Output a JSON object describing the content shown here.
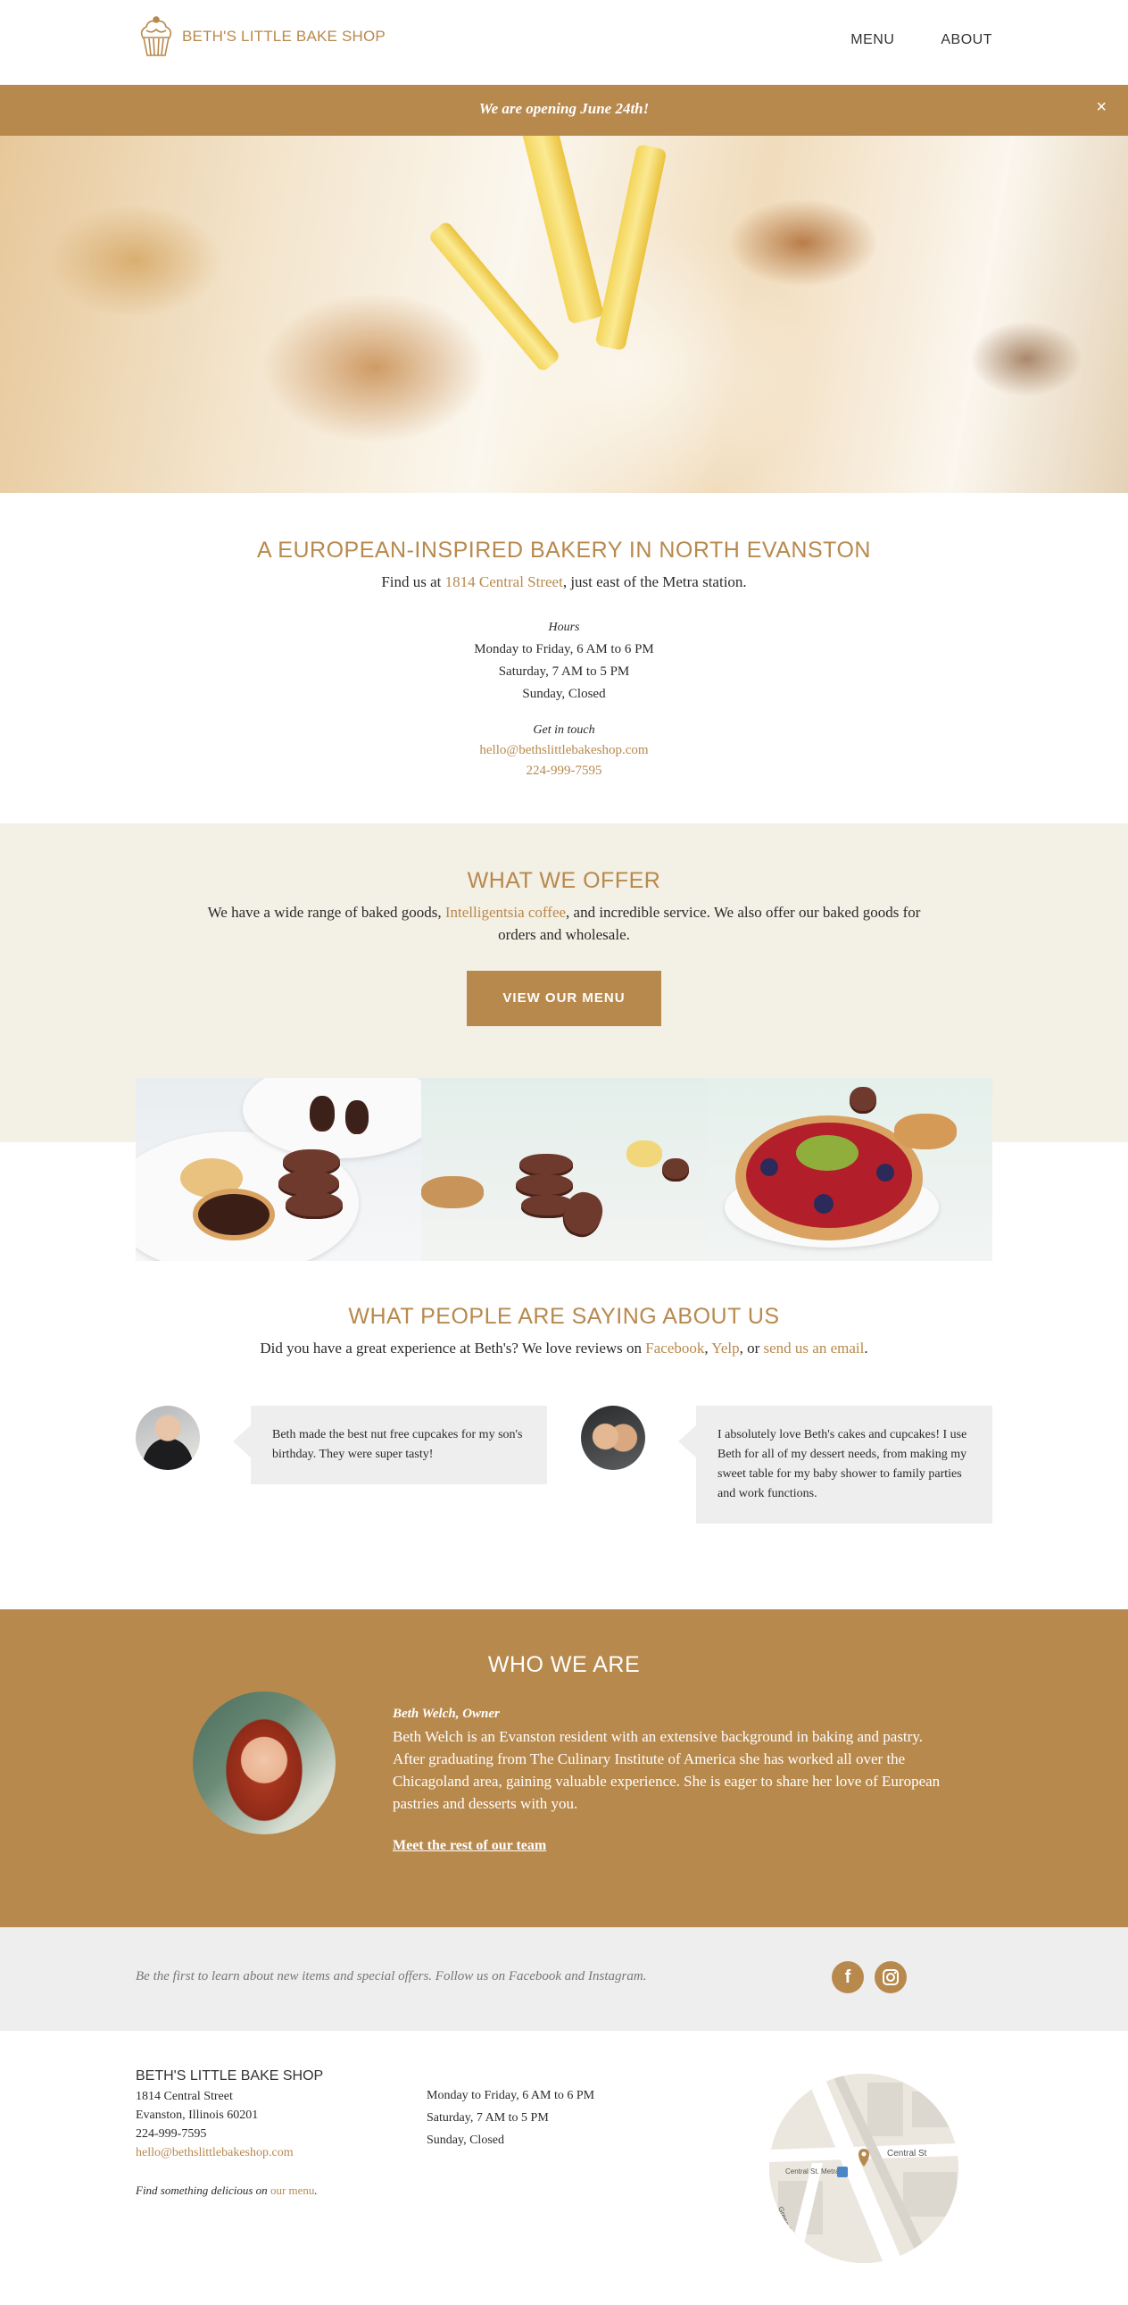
{
  "header": {
    "logo_text": "BETH'S LITTLE BAKE SHOP",
    "nav": [
      "MENU",
      "ABOUT"
    ]
  },
  "banner": {
    "text": "We are opening June 24th!",
    "close": "×"
  },
  "intro": {
    "title": "A EUROPEAN-INSPIRED BAKERY IN NORTH EVANSTON",
    "find_prefix": "Find us at ",
    "find_link": "1814 Central Street",
    "find_suffix": ", just east of the Metra station.",
    "hours_label": "Hours",
    "hours": [
      "Monday to Friday,  6 AM to 6 PM",
      "Saturday,  7 AM to 5 PM",
      "Sunday, Closed"
    ],
    "contact_label": "Get in touch",
    "email": "hello@bethslittlebakeshop.com",
    "phone": "224-999-7595"
  },
  "offer": {
    "title": "WHAT WE OFFER",
    "text_prefix": "We have a wide range of baked goods, ",
    "text_link": "Intelligentsia coffee",
    "text_suffix": ", and incredible service. We also offer our baked goods for orders and wholesale.",
    "button": "VIEW OUR MENU"
  },
  "reviews": {
    "title": "WHAT PEOPLE ARE SAYING ABOUT US",
    "lead_prefix": "Did you have a great experience at Beth's? We love reviews on ",
    "link_facebook": "Facebook",
    "sep1": ", ",
    "link_yelp": "Yelp",
    "sep2": ", or ",
    "link_email": "send us an email",
    "lead_suffix": ".",
    "items": [
      {
        "text": "Beth made the best nut free cupcakes for my son's birthday. They were super tasty!"
      },
      {
        "text": "I absolutely love Beth's cakes and cupcakes! I use Beth for all of my dessert needs, from making my sweet table for my baby shower to family parties and work functions."
      }
    ]
  },
  "who": {
    "title": "WHO WE ARE",
    "name": "Beth Welch, Owner",
    "bio": "Beth Welch is an Evanston resident with an extensive background in baking and pastry. After graduating from The Culinary Institute of America she has worked all over the Chicagoland area, gaining valuable experience. She is eager to share her love of European pastries and desserts with you.",
    "link": "Meet the rest of our team"
  },
  "social": {
    "text": "Be the first to learn about new items and special offers. Follow us on Facebook and Instagram.",
    "icons": [
      "facebook-icon",
      "instagram-icon"
    ]
  },
  "footer": {
    "title": "BETH'S LITTLE BAKE SHOP",
    "address1": "1814 Central Street",
    "address2": "Evanston, Illinois 60201",
    "phone": "224-999-7595",
    "email": "hello@bethslittlebakeshop.com",
    "find_prefix": "Find something delicious on ",
    "find_link": "our menu",
    "find_suffix": ".",
    "hours": [
      "Monday to Friday,  6 AM to 6 PM",
      "Saturday,  7 AM to 5 PM",
      "Sunday, Closed"
    ],
    "map_labels": {
      "street1": "Central St",
      "station": "Central St. Metra",
      "street2": "Green Bay Rd"
    }
  },
  "colors": {
    "accent": "#b8894d",
    "offer_bg": "#f3f0e5",
    "grey_bg": "#eeeeee"
  }
}
